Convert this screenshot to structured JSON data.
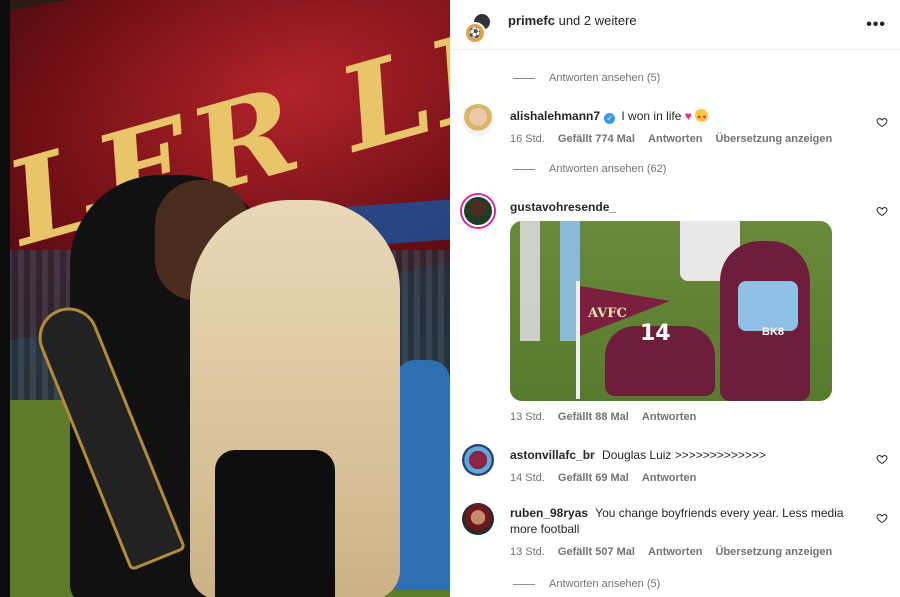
{
  "photo": {
    "banner_text": "LER LEAGU"
  },
  "header": {
    "user": "primefc",
    "suffix": "und 2 weitere",
    "more": "•••"
  },
  "replies_top": "Antworten ansehen (5)",
  "comments": [
    {
      "user": "alishalehmann7",
      "verified": true,
      "text": "I won in life",
      "time": "16 Std.",
      "likes": "Gefällt 774 Mal",
      "reply": "Antworten",
      "translate": "Übersetzung anzeigen",
      "replies": "Antworten ansehen (62)"
    },
    {
      "user": "gustavohresende_",
      "text": "",
      "time": "13 Std.",
      "likes": "Gefällt 88 Mal",
      "reply": "Antworten",
      "gif": {
        "flag_text": "AVFC",
        "shirt_number": "14",
        "sponsor": "BK8"
      }
    },
    {
      "user": "astonvillafc_br",
      "text": "Douglas Luiz >>>>>>>>>>>>>",
      "time": "14 Std.",
      "likes": "Gefällt 69 Mal",
      "reply": "Antworten"
    },
    {
      "user": "ruben_98ryas",
      "text": "You change boyfriends every year. Less media more football",
      "time": "13 Std.",
      "likes": "Gefällt 507 Mal",
      "reply": "Antworten",
      "translate": "Übersetzung anzeigen",
      "replies": "Antworten ansehen (5)"
    }
  ],
  "colors": {
    "verified": "#3897f0",
    "story_ring": "#d6249f",
    "muted": "#737373"
  }
}
